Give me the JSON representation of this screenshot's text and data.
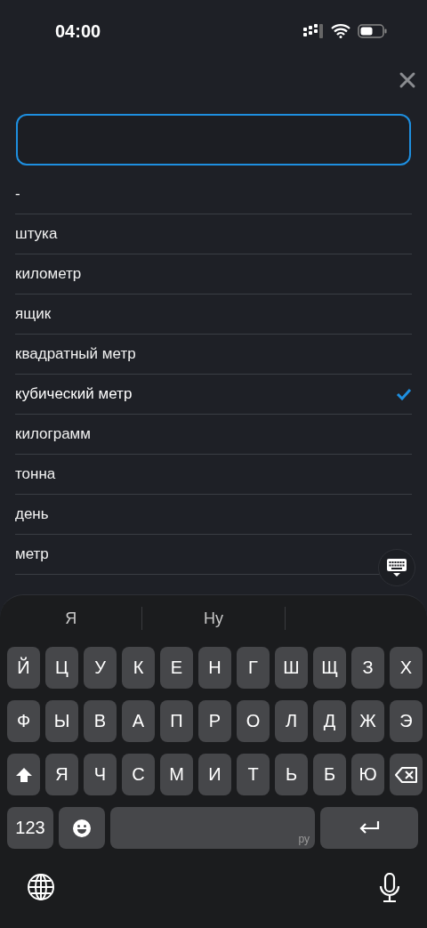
{
  "status_bar": {
    "time": "04:00"
  },
  "search": {
    "focused": true
  },
  "units": [
    {
      "label": "-",
      "selected": false
    },
    {
      "label": "штука",
      "selected": false
    },
    {
      "label": "километр",
      "selected": false
    },
    {
      "label": "ящик",
      "selected": false
    },
    {
      "label": "квадратный метр",
      "selected": false
    },
    {
      "label": "кубический метр",
      "selected": true
    },
    {
      "label": "килограмм",
      "selected": false
    },
    {
      "label": "тонна",
      "selected": false
    },
    {
      "label": "день",
      "selected": false
    },
    {
      "label": "метр",
      "selected": false
    }
  ],
  "keyboard": {
    "suggestions": [
      "Я",
      "Ну"
    ],
    "rows": [
      [
        {
          "kind": "letter",
          "label": "Й"
        },
        {
          "kind": "letter",
          "label": "Ц"
        },
        {
          "kind": "letter",
          "label": "У"
        },
        {
          "kind": "letter",
          "label": "К"
        },
        {
          "kind": "letter",
          "label": "Е"
        },
        {
          "kind": "letter",
          "label": "Н"
        },
        {
          "kind": "letter",
          "label": "Г"
        },
        {
          "kind": "letter",
          "label": "Ш"
        },
        {
          "kind": "letter",
          "label": "Щ"
        },
        {
          "kind": "letter",
          "label": "З"
        },
        {
          "kind": "letter",
          "label": "Х"
        }
      ],
      [
        {
          "kind": "letter",
          "label": "Ф"
        },
        {
          "kind": "letter",
          "label": "Ы"
        },
        {
          "kind": "letter",
          "label": "В"
        },
        {
          "kind": "letter",
          "label": "А"
        },
        {
          "kind": "letter",
          "label": "П"
        },
        {
          "kind": "letter",
          "label": "Р"
        },
        {
          "kind": "letter",
          "label": "О"
        },
        {
          "kind": "letter",
          "label": "Л"
        },
        {
          "kind": "letter",
          "label": "Д"
        },
        {
          "kind": "letter",
          "label": "Ж"
        },
        {
          "kind": "letter",
          "label": "Э"
        }
      ],
      [
        {
          "kind": "shift"
        },
        {
          "kind": "letter",
          "label": "Я"
        },
        {
          "kind": "letter",
          "label": "Ч"
        },
        {
          "kind": "letter",
          "label": "С"
        },
        {
          "kind": "letter",
          "label": "М"
        },
        {
          "kind": "letter",
          "label": "И"
        },
        {
          "kind": "letter",
          "label": "Т"
        },
        {
          "kind": "letter",
          "label": "Ь"
        },
        {
          "kind": "letter",
          "label": "Б"
        },
        {
          "kind": "letter",
          "label": "Ю"
        },
        {
          "kind": "backspace"
        }
      ],
      [
        {
          "kind": "numbers",
          "label": "123"
        },
        {
          "kind": "emoji"
        },
        {
          "kind": "space",
          "label": "ру"
        },
        {
          "kind": "return"
        }
      ]
    ]
  }
}
